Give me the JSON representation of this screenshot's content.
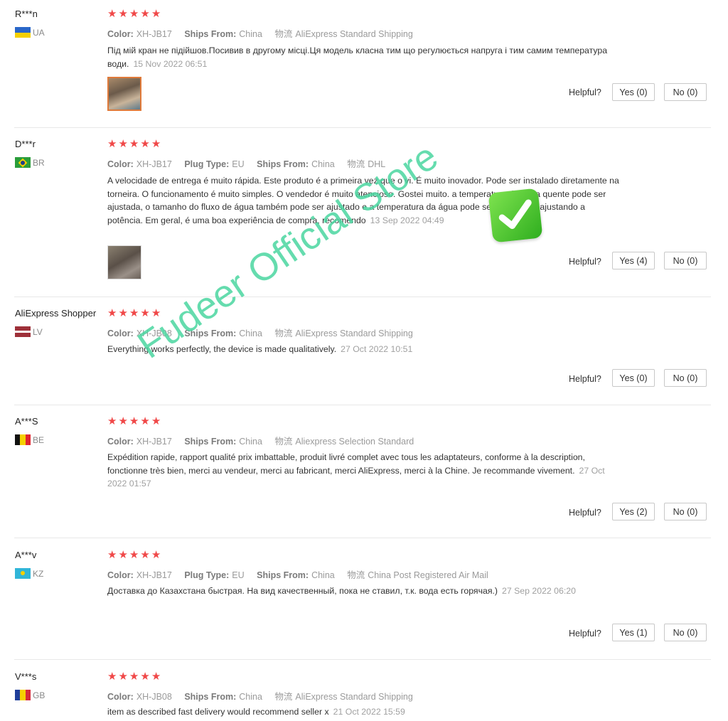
{
  "helpful_label": "Helpful?",
  "reviews": [
    {
      "user": "R***n",
      "country": "UA",
      "flag": "ua",
      "attrs": [
        {
          "k": "Color:",
          "v": "XH-JB17"
        },
        {
          "k": "Ships From:",
          "v": "China"
        }
      ],
      "shipping_label": "物流",
      "shipping": "AliExpress Standard Shipping",
      "text": "Під мій кран не підійшов.Посивив в другому місці.Ця модель класна тим що регулюється напруга і тим самим температура води.",
      "date": "15 Nov 2022 06:51",
      "yes": "Yes (0)",
      "no": "No (0)"
    },
    {
      "user": "D***r",
      "country": "BR",
      "flag": "br",
      "attrs": [
        {
          "k": "Color:",
          "v": "XH-JB17"
        },
        {
          "k": "Plug Type:",
          "v": "EU"
        },
        {
          "k": "Ships From:",
          "v": "China"
        }
      ],
      "shipping_label": "物流",
      "shipping": "DHL",
      "text": "A velocidade de entrega é muito rápida. Este produto é a primeira vez que o vi. É muito inovador. Pode ser instalado diretamente na torneira. O funcionamento é muito simples. O vendedor é muito atencioso. Gostei muito. a temperatura da água quente pode ser ajustada, o tamanho do fluxo de água também pode ser ajustado e a temperatura da água pode ser controlada ajustando a potência. Em geral, é uma boa experiência de compra, recomendo",
      "date": "13 Sep 2022 04:49",
      "yes": "Yes (4)",
      "no": "No (0)"
    },
    {
      "user": "AliExpress Shopper",
      "country": "LV",
      "flag": "lv",
      "attrs": [
        {
          "k": "Color:",
          "v": "XH-JB08"
        },
        {
          "k": "Ships From:",
          "v": "China"
        }
      ],
      "shipping_label": "物流",
      "shipping": "AliExpress Standard Shipping",
      "text": "Everything works perfectly, the device is made qualitatively.",
      "date": "27 Oct 2022 10:51",
      "yes": "Yes (0)",
      "no": "No (0)"
    },
    {
      "user": "A***S",
      "country": "BE",
      "flag": "be",
      "attrs": [
        {
          "k": "Color:",
          "v": "XH-JB17"
        },
        {
          "k": "Ships From:",
          "v": "China"
        }
      ],
      "shipping_label": "物流",
      "shipping": "Aliexpress Selection Standard",
      "text": "Expédition rapide, rapport qualité prix imbattable, produit livré complet avec tous les adaptateurs, conforme à la description, fonctionne très bien, merci au vendeur, merci au fabricant, merci AliExpress, merci à la Chine. Je recommande vivement.",
      "date": "27 Oct 2022 01:57",
      "yes": "Yes (2)",
      "no": "No (0)"
    },
    {
      "user": "A***v",
      "country": "KZ",
      "flag": "kz",
      "attrs": [
        {
          "k": "Color:",
          "v": "XH-JB17"
        },
        {
          "k": "Plug Type:",
          "v": "EU"
        },
        {
          "k": "Ships From:",
          "v": "China"
        }
      ],
      "shipping_label": "物流",
      "shipping": "China Post Registered Air Mail",
      "text": "Доставка до Казахстана быстрая. На вид качественный, пока не ставил, т.к. вода есть горячая.)",
      "date": "27 Sep 2022 06:20",
      "yes": "Yes (1)",
      "no": "No (0)"
    },
    {
      "user": "V***s",
      "country": "GB",
      "flag": "ad",
      "attrs": [
        {
          "k": "Color:",
          "v": "XH-JB08"
        },
        {
          "k": "Ships From:",
          "v": "China"
        }
      ],
      "shipping_label": "物流",
      "shipping": "AliExpress Standard Shipping",
      "text": "item as described fast delivery would recommend seller x",
      "date": "21 Oct 2022 15:59",
      "yes": "",
      "no": ""
    }
  ],
  "watermark": "Fudeer Official Store",
  "colors": {
    "star": "#f04848",
    "watermark": "#4ad6a0",
    "active_thumb_border": "#e07a3a"
  }
}
